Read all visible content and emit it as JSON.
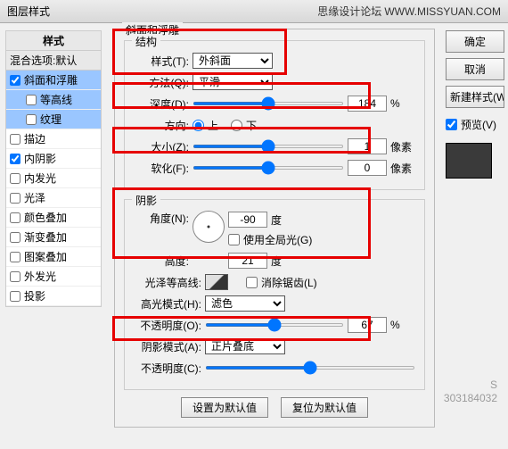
{
  "titlebar": {
    "title": "图层样式",
    "brand": "思缘设计论坛",
    "brand_url": "WWW.MISSYUAN.COM"
  },
  "sidebar": {
    "header": "样式",
    "blend": "混合选项:默认",
    "items": [
      {
        "label": "斜面和浮雕",
        "checked": true,
        "selected": true,
        "sub": false
      },
      {
        "label": "等高线",
        "checked": false,
        "selected": true,
        "sub": true
      },
      {
        "label": "纹理",
        "checked": false,
        "selected": true,
        "sub": true
      },
      {
        "label": "描边",
        "checked": false,
        "selected": false,
        "sub": false
      },
      {
        "label": "内阴影",
        "checked": true,
        "selected": false,
        "sub": false
      },
      {
        "label": "内发光",
        "checked": false,
        "selected": false,
        "sub": false
      },
      {
        "label": "光泽",
        "checked": false,
        "selected": false,
        "sub": false
      },
      {
        "label": "颜色叠加",
        "checked": false,
        "selected": false,
        "sub": false
      },
      {
        "label": "渐变叠加",
        "checked": false,
        "selected": false,
        "sub": false
      },
      {
        "label": "图案叠加",
        "checked": false,
        "selected": false,
        "sub": false
      },
      {
        "label": "外发光",
        "checked": false,
        "selected": false,
        "sub": false
      },
      {
        "label": "投影",
        "checked": false,
        "selected": false,
        "sub": false
      }
    ]
  },
  "panel": {
    "title": "斜面和浮雕",
    "structure": {
      "legend": "结构",
      "style_label": "样式(T):",
      "style_value": "外斜面",
      "technique_label": "方法(Q):",
      "technique_value": "平滑",
      "depth_label": "深度(D):",
      "depth_value": "184",
      "depth_unit": "%",
      "direction_label": "方向:",
      "dir_up": "上",
      "dir_down": "下",
      "size_label": "大小(Z):",
      "size_value": "1",
      "size_unit": "像素",
      "soften_label": "软化(F):",
      "soften_value": "0",
      "soften_unit": "像素"
    },
    "shading": {
      "legend": "阴影",
      "angle_label": "角度(N):",
      "angle_value": "-90",
      "angle_unit": "度",
      "global_label": "使用全局光(G)",
      "altitude_label": "高度:",
      "altitude_value": "21",
      "altitude_unit": "度",
      "contour_label": "光泽等高线:",
      "antialias_label": "消除锯齿(L)",
      "hmode_label": "高光模式(H):",
      "hmode_value": "滤色",
      "hopacity_label": "不透明度(O):",
      "hopacity_value": "67",
      "hopacity_unit": "%",
      "smode_label": "阴影模式(A):",
      "smode_value": "正片叠底",
      "sopacity_label": "不透明度(C):"
    },
    "footer": {
      "default": "设置为默认值",
      "reset": "复位为默认值"
    }
  },
  "buttons": {
    "ok": "确定",
    "cancel": "取消",
    "newstyle": "新建样式(W",
    "preview": "预览(V)"
  },
  "watermark": {
    "line1": "S",
    "line2": "303184032"
  }
}
